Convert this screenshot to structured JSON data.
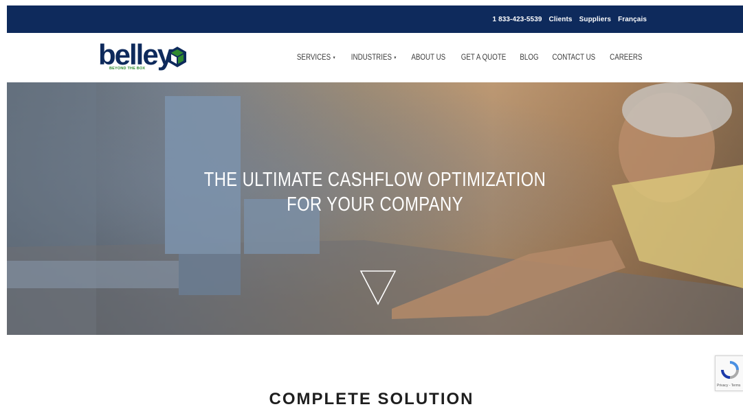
{
  "topbar": {
    "phone": "1 833-423-5539",
    "clients": "Clients",
    "suppliers": "Suppliers",
    "language": "Français"
  },
  "logo": {
    "wordmark": "belley",
    "tagline": "BEYOND THE BOX"
  },
  "nav": {
    "items": [
      {
        "label": "SERVICES",
        "dropdown": true
      },
      {
        "label": "INDUSTRIES",
        "dropdown": true
      },
      {
        "label": "ABOUT US"
      },
      {
        "label": "GET A QUOTE"
      },
      {
        "label": "BLOG"
      },
      {
        "label": "CONTACT US"
      },
      {
        "label": "CAREERS"
      }
    ]
  },
  "hero": {
    "title_line1": "THE ULTIMATE CASHFLOW OPTIMIZATION",
    "title_line2": "FOR YOUR COMPANY",
    "scroll_icon": "triangle-down-icon"
  },
  "recaptcha": {
    "text": "Privacy - Terms"
  },
  "section": {
    "heading": "COMPLETE SOLUTION"
  },
  "colors": {
    "topbar": "#0e2a5c",
    "brand_navy": "#0e2a5c",
    "brand_green": "#2f8a2f",
    "nav_text": "#3b3b3b"
  }
}
